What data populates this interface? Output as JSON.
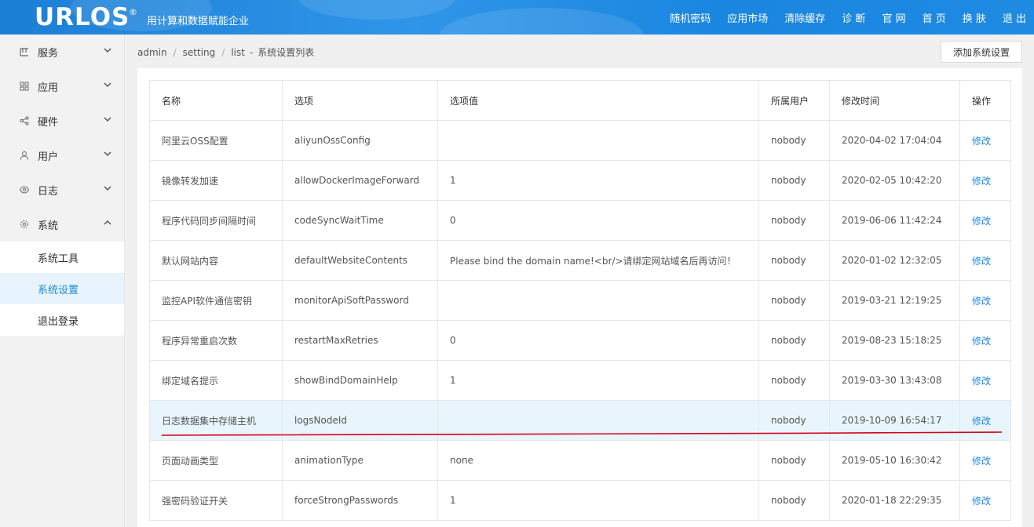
{
  "header": {
    "logo": "URLOS",
    "reg": "®",
    "slogan": "用计算和数据赋能企业",
    "nav": [
      "随机密码",
      "应用市场",
      "清除缓存",
      "诊 断",
      "官 网",
      "首 页",
      "换 肤",
      "退 出"
    ]
  },
  "sidebar": {
    "items": [
      {
        "label": "服务",
        "icon": "grid-icon",
        "expanded": false
      },
      {
        "label": "应用",
        "icon": "apps-icon",
        "expanded": false
      },
      {
        "label": "硬件",
        "icon": "share-icon",
        "expanded": false
      },
      {
        "label": "用户",
        "icon": "user-icon",
        "expanded": false
      },
      {
        "label": "日志",
        "icon": "eye-icon",
        "expanded": false
      },
      {
        "label": "系统",
        "icon": "gear-icon",
        "expanded": true
      }
    ],
    "subitems": [
      "系统工具",
      "系统设置",
      "退出登录"
    ],
    "active_sub": "系统设置"
  },
  "breadcrumb": [
    "admin",
    "setting",
    "list",
    "系统设置列表"
  ],
  "add_button": "添加系统设置",
  "table": {
    "headers": [
      "名称",
      "选项",
      "选项值",
      "所属用户",
      "修改时间",
      "操作"
    ],
    "rows": [
      [
        "阿里云OSS配置",
        "aliyunOssConfig",
        "",
        "nobody",
        "2020-04-02 17:04:04",
        "修改"
      ],
      [
        "镜像转发加速",
        "allowDockerImageForward",
        "1",
        "nobody",
        "2020-02-05 10:42:20",
        "修改"
      ],
      [
        "程序代码同步间隔时间",
        "codeSyncWaitTime",
        "0",
        "nobody",
        "2019-06-06 11:42:24",
        "修改"
      ],
      [
        "默认网站内容",
        "defaultWebsiteContents",
        "Please bind the domain name!<br/>请绑定网站域名后再访问！",
        "nobody",
        "2020-01-02 12:32:05",
        "修改"
      ],
      [
        "监控API软件通信密钥",
        "monitorApiSoftPassword",
        "",
        "nobody",
        "2019-03-21 12:19:25",
        "修改"
      ],
      [
        "程序异常重启次数",
        "restartMaxRetries",
        "0",
        "nobody",
        "2019-08-23 15:18:25",
        "修改"
      ],
      [
        "绑定域名提示",
        "showBindDomainHelp",
        "1",
        "nobody",
        "2019-03-30 13:43:08",
        "修改"
      ],
      [
        "日志数据集中存储主机",
        "logsNodeId",
        "",
        "nobody",
        "2019-10-09 16:54:17",
        "修改"
      ],
      [
        "页面动画类型",
        "animationType",
        "none",
        "nobody",
        "2019-05-10 16:30:42",
        "修改"
      ],
      [
        "强密码验证开关",
        "forceStrongPasswords",
        "1",
        "nobody",
        "2020-01-18 22:29:35",
        "修改"
      ]
    ],
    "highlighted_row": 7
  },
  "colors": {
    "accent": "#1e88e5",
    "header": "#1f8ae2",
    "highlight": "#e8f5fd",
    "annotation": "#d9001b"
  }
}
